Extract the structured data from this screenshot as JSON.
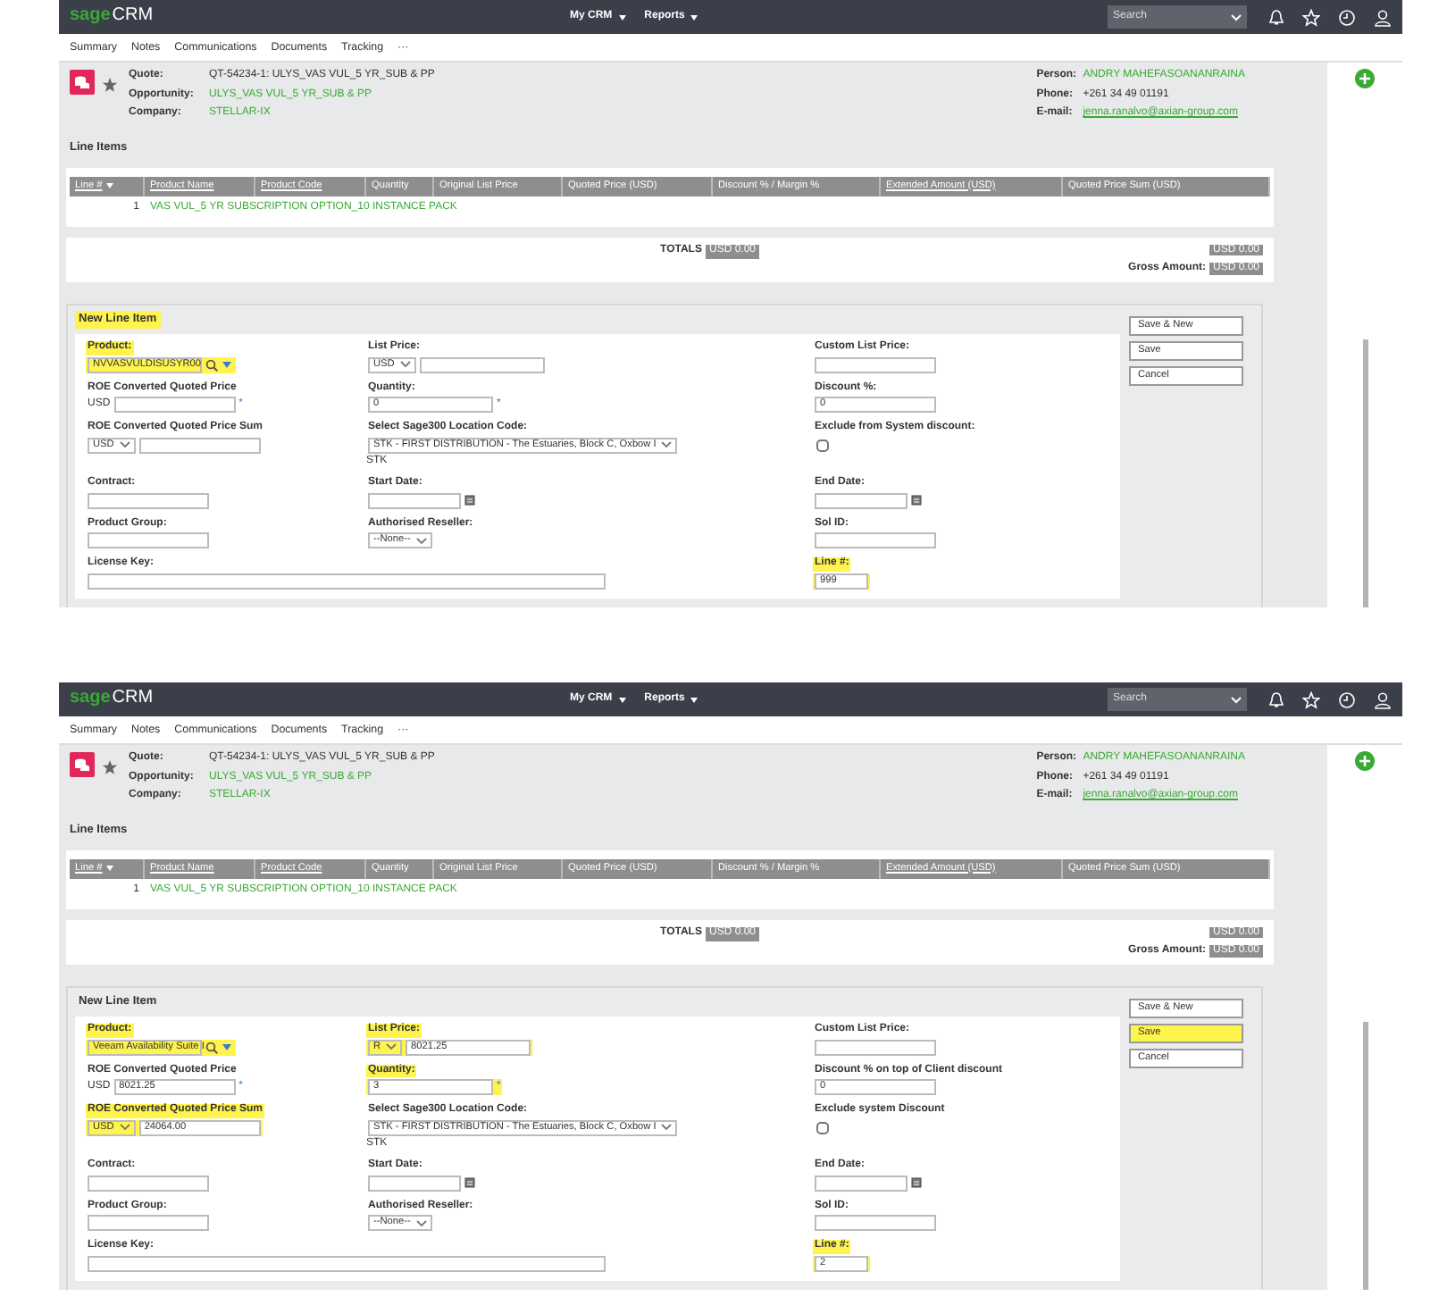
{
  "screens": [
    {
      "topbar": {
        "brand": "sage",
        "product": "CRM",
        "menus": [
          "My CRM",
          "Reports"
        ],
        "search": "Search"
      },
      "tabs": [
        "Summary",
        "Notes",
        "Communications",
        "Documents",
        "Tracking",
        "···"
      ],
      "record": {
        "left": [
          {
            "label": "Quote:",
            "value": "QT-54234-1: ULYS_VAS VUL_5 YR_SUB & PP",
            "kind": "text"
          },
          {
            "label": "Opportunity:",
            "value": "ULYS_VAS VUL_5 YR_SUB & PP",
            "kind": "link"
          },
          {
            "label": "Company:",
            "value": "STELLAR-IX",
            "kind": "link"
          }
        ],
        "right": [
          {
            "label": "Person:",
            "value": "ANDRY MAHEFASOANANRAINA",
            "kind": "link"
          },
          {
            "label": "Phone:",
            "value": "+261 34 49 01191",
            "kind": "text"
          },
          {
            "label": "E-mail:",
            "value": "jenna.ranalvo@axian-group.com",
            "kind": "email"
          }
        ]
      },
      "line_items": {
        "title": "Line Items",
        "columns": [
          {
            "label": "Line #",
            "sortable": true,
            "sorted": true
          },
          {
            "label": "Product Name",
            "sortable": true,
            "sorted": false
          },
          {
            "label": "Product Code",
            "sortable": true,
            "sorted": false
          },
          {
            "label": "Quantity",
            "sortable": false,
            "sorted": false
          },
          {
            "label": "Original List Price",
            "sortable": false,
            "sorted": false
          },
          {
            "label": "Quoted Price (USD)",
            "sortable": false,
            "sorted": false
          },
          {
            "label": "Discount % / Margin %",
            "sortable": false,
            "sorted": false
          },
          {
            "label": "Extended Amount (USD)",
            "sortable": true,
            "sorted": false
          },
          {
            "label": "Quoted Price Sum (USD)",
            "sortable": false,
            "sorted": false
          }
        ],
        "rows": [
          [
            "1",
            "VAS VUL_5 YR SUBSCRIPTION OPTION_10 INSTANCE PACK"
          ]
        ]
      },
      "totals": {
        "label": "TOTALS",
        "amount": "USD 0.00",
        "right_amount": "USD 0.00",
        "gross_label": "Gross Amount:",
        "gross_amount": "USD 0.00"
      },
      "form": {
        "title": "New Line Item",
        "highlighted": true,
        "rows": [
          [
            {
              "kind": "lookup",
              "label": "Product:",
              "value": "NVVASVULDISUSYR00",
              "highlighted": true
            },
            {
              "kind": "select_input",
              "label": "List Price:",
              "option": "USD",
              "highlighted": false
            },
            {
              "kind": "input",
              "label": "Custom List Price:",
              "highlighted": false
            }
          ],
          [
            {
              "kind": "prefix_input",
              "label": "ROE Converted Quoted Price",
              "prefix": "USD",
              "marker": "*",
              "highlighted": false
            },
            {
              "kind": "input",
              "label": "Quantity:",
              "value": "0",
              "marker": "*",
              "highlighted": false
            },
            {
              "kind": "input",
              "label": "Discount %:",
              "value": "0",
              "highlighted": false
            }
          ],
          [
            {
              "kind": "select_input",
              "label": "ROE Converted Quoted Price Sum",
              "option": "USD",
              "highlighted": false
            },
            {
              "kind": "select",
              "label": "Select Sage300 Location Code:",
              "option": "STK - FIRST DISTRIBUTION - The Estuaries, Block C, Oxbow I",
              "note": "STK",
              "highlighted": false
            },
            {
              "kind": "checkbox",
              "label": "Exclude from System discount:",
              "checked": false,
              "highlighted": false
            }
          ],
          [
            {
              "kind": "input",
              "label": "Contract:",
              "highlighted": false
            },
            {
              "kind": "date",
              "label": "Start Date:",
              "highlighted": false
            },
            {
              "kind": "date",
              "label": "End Date:",
              "highlighted": false
            }
          ],
          [
            {
              "kind": "input",
              "label": "Product Group:",
              "highlighted": false
            },
            {
              "kind": "select",
              "label": "Authorised Reseller:",
              "option": "--None--",
              "highlighted": false
            },
            {
              "kind": "input",
              "label": "Sol ID:",
              "highlighted": false
            }
          ],
          [
            {
              "kind": "input",
              "label": "License Key:",
              "highlighted": false
            },
            "",
            {
              "kind": "input",
              "label": "Line #:",
              "value": "999",
              "highlighted": true
            }
          ]
        ],
        "buttons": [
          {
            "label": "Save & New",
            "highlighted": false
          },
          {
            "label": "Save",
            "highlighted": false
          },
          {
            "label": "Cancel",
            "highlighted": false
          }
        ]
      }
    },
    {
      "topbar": {
        "brand": "sage",
        "product": "CRM",
        "menus": [
          "My CRM",
          "Reports"
        ],
        "search": "Search"
      },
      "tabs": [
        "Summary",
        "Notes",
        "Communications",
        "Documents",
        "Tracking",
        "···"
      ],
      "record": {
        "left": [
          {
            "label": "Quote:",
            "value": "QT-54234-1: ULYS_VAS VUL_5 YR_SUB & PP",
            "kind": "text"
          },
          {
            "label": "Opportunity:",
            "value": "ULYS_VAS VUL_5 YR_SUB & PP",
            "kind": "link"
          },
          {
            "label": "Company:",
            "value": "STELLAR-IX",
            "kind": "link"
          }
        ],
        "right": [
          {
            "label": "Person:",
            "value": "ANDRY MAHEFASOANANRAINA",
            "kind": "link"
          },
          {
            "label": "Phone:",
            "value": "+261 34 49 01191",
            "kind": "text"
          },
          {
            "label": "E-mail:",
            "value": "jenna.ranalvo@axian-group.com",
            "kind": "email"
          }
        ]
      },
      "line_items": {
        "title": "Line Items",
        "columns": [
          {
            "label": "Line #",
            "sortable": true,
            "sorted": true
          },
          {
            "label": "Product Name",
            "sortable": true,
            "sorted": false
          },
          {
            "label": "Product Code",
            "sortable": true,
            "sorted": false
          },
          {
            "label": "Quantity",
            "sortable": false,
            "sorted": false
          },
          {
            "label": "Original List Price",
            "sortable": false,
            "sorted": false
          },
          {
            "label": "Quoted Price (USD)",
            "sortable": false,
            "sorted": false
          },
          {
            "label": "Discount % / Margin %",
            "sortable": false,
            "sorted": false
          },
          {
            "label": "Extended Amount (USD)",
            "sortable": true,
            "sorted": false
          },
          {
            "label": "Quoted Price Sum (USD)",
            "sortable": false,
            "sorted": false
          }
        ],
        "rows": [
          [
            "1",
            "VAS VUL_5 YR SUBSCRIPTION OPTION_10 INSTANCE PACK"
          ]
        ]
      },
      "totals": {
        "label": "TOTALS",
        "amount": "USD 0.00",
        "right_amount": "USD 0.00",
        "gross_label": "Gross Amount:",
        "gross_amount": "USD 0.00"
      },
      "form": {
        "title": "New Line Item",
        "highlighted": false,
        "rows": [
          [
            {
              "kind": "lookup",
              "label": "Product:",
              "value": "Veeam Availability Suite I",
              "highlighted": true
            },
            {
              "kind": "select_input",
              "label": "List Price:",
              "option": "R",
              "value": "8021.25",
              "highlighted": true
            },
            {
              "kind": "input",
              "label": "Custom List Price:",
              "highlighted": false
            }
          ],
          [
            {
              "kind": "prefix_input",
              "label": "ROE Converted Quoted Price",
              "prefix": "USD",
              "value": "8021.25",
              "marker": "*",
              "highlighted": false
            },
            {
              "kind": "input",
              "label": "Quantity:",
              "value": "3",
              "marker": "*",
              "highlighted": true
            },
            {
              "kind": "input",
              "label": "Discount % on top of Client discount",
              "value": "0",
              "highlighted": false
            }
          ],
          [
            {
              "kind": "select_input",
              "label": "ROE Converted Quoted Price Sum",
              "option": "USD",
              "value": "24064.00",
              "highlighted": true
            },
            {
              "kind": "select",
              "label": "Select Sage300 Location Code:",
              "option": "STK - FIRST DISTRIBUTION - The Estuaries, Block C, Oxbow I",
              "note": "STK",
              "highlighted": false
            },
            {
              "kind": "checkbox",
              "label": "Exclude system Discount",
              "checked": false,
              "highlighted": false
            }
          ],
          [
            {
              "kind": "input",
              "label": "Contract:",
              "highlighted": false
            },
            {
              "kind": "date",
              "label": "Start Date:",
              "highlighted": false
            },
            {
              "kind": "date",
              "label": "End Date:",
              "highlighted": false
            }
          ],
          [
            {
              "kind": "input",
              "label": "Product Group:",
              "highlighted": false
            },
            {
              "kind": "select",
              "label": "Authorised Reseller:",
              "option": "--None--",
              "highlighted": false
            },
            {
              "kind": "input",
              "label": "Sol ID:",
              "highlighted": false
            }
          ],
          [
            {
              "kind": "input",
              "label": "License Key:",
              "highlighted": false
            },
            "",
            {
              "kind": "input",
              "label": "Line #:",
              "value": "2",
              "highlighted": true
            }
          ]
        ],
        "buttons": [
          {
            "label": "Save & New",
            "highlighted": false
          },
          {
            "label": "Save",
            "highlighted": true
          },
          {
            "label": "Cancel",
            "highlighted": false
          }
        ]
      }
    }
  ]
}
